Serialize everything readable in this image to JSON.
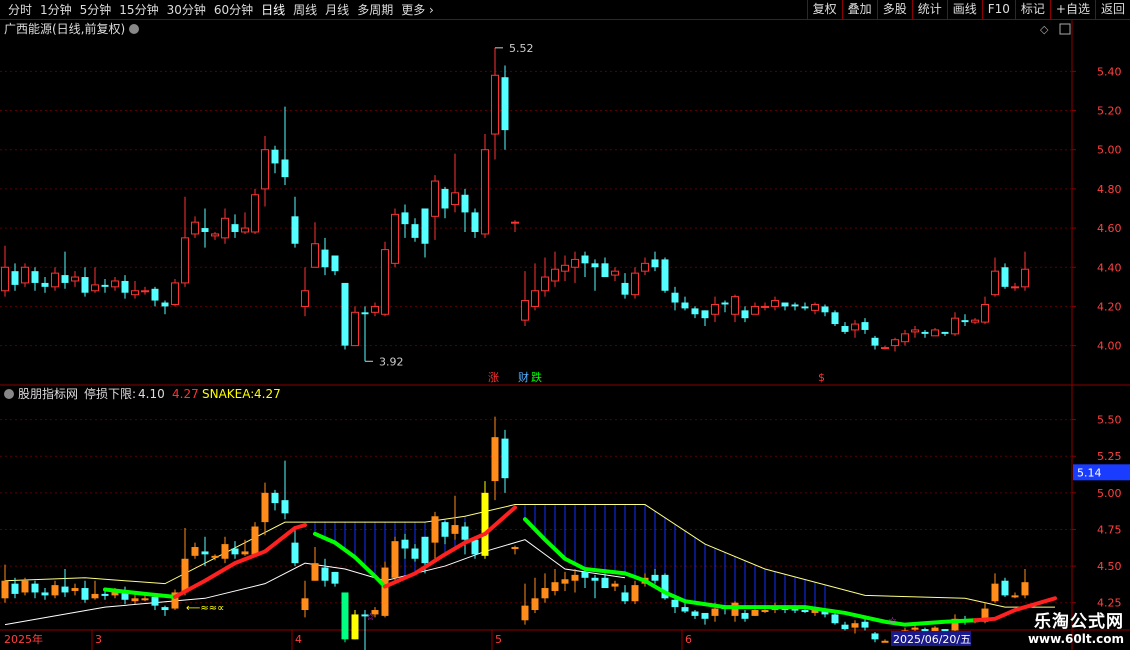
{
  "toolbar": {
    "periods": [
      "分时",
      "1分钟",
      "5分钟",
      "15分钟",
      "30分钟",
      "60分钟",
      "日线",
      "周线",
      "月线",
      "多周期"
    ],
    "active_period": "日线",
    "more_label": "更多",
    "right_buttons": [
      "复权",
      "叠加",
      "多股",
      "统计",
      "画线",
      "F10",
      "标记",
      "+自选",
      "返回"
    ]
  },
  "main_panel": {
    "title": "广西能源(日线,前复权)",
    "high_label": "5.52",
    "low_label": "3.92",
    "events": [
      "涨",
      "财",
      "跌",
      "$"
    ]
  },
  "indicator_panel": {
    "name": "股朋指标网",
    "stop_label": "停损下限:",
    "stop_value": "4.10",
    "value2": "4.27",
    "snake_label": "SNAKEA:",
    "snake_value": "4.27",
    "current_price": "5.14",
    "signal_text": "⟵≈≈∝"
  },
  "xaxis": {
    "year_label": "2025年",
    "months": [
      {
        "label": "3",
        "index": 9
      },
      {
        "label": "4",
        "index": 29
      },
      {
        "label": "5",
        "index": 49
      },
      {
        "label": "6",
        "index": 68
      }
    ],
    "cursor_date": "2025/06/20/五"
  },
  "watermark": {
    "title": "乐淘公式网",
    "url": "www.60lt.com"
  },
  "colors": {
    "up": "#ff3232",
    "down": "#54ffff",
    "snake_green": "#00ff00",
    "snake_red": "#ff2020",
    "orange": "#ff8c1a",
    "yellow": "#ffff00",
    "blue_fill": "#1030ff",
    "accent_red": "#8b0000"
  },
  "chart_data": {
    "type": "candlestick",
    "main_yaxis": {
      "ticks": [
        4.0,
        4.2,
        4.4,
        4.6,
        4.8,
        5.0,
        5.2,
        5.4
      ],
      "ylim": [
        3.85,
        5.56
      ]
    },
    "ind_yaxis": {
      "ticks": [
        4.25,
        4.5,
        4.75,
        5.0,
        5.25,
        5.5
      ],
      "ylim": [
        4.05,
        5.62
      ]
    },
    "candles": [
      [
        4.28,
        4.4,
        4.51,
        4.25
      ],
      [
        4.38,
        4.31,
        4.42,
        4.28
      ],
      [
        4.32,
        4.4,
        4.42,
        4.3
      ],
      [
        4.38,
        4.32,
        4.4,
        4.28
      ],
      [
        4.32,
        4.3,
        4.35,
        4.27
      ],
      [
        4.3,
        4.37,
        4.4,
        4.28
      ],
      [
        4.36,
        4.32,
        4.48,
        4.29
      ],
      [
        4.33,
        4.35,
        4.38,
        4.3
      ],
      [
        4.35,
        4.27,
        4.4,
        4.25
      ],
      [
        4.28,
        4.31,
        4.4,
        4.27
      ],
      [
        4.31,
        4.3,
        4.34,
        4.27
      ],
      [
        4.3,
        4.33,
        4.35,
        4.28
      ],
      [
        4.33,
        4.27,
        4.36,
        4.24
      ],
      [
        4.26,
        4.28,
        4.33,
        4.24
      ],
      [
        4.28,
        4.28,
        4.3,
        4.26
      ],
      [
        4.29,
        4.23,
        4.3,
        4.2
      ],
      [
        4.22,
        4.2,
        4.23,
        4.16
      ],
      [
        4.21,
        4.32,
        4.34,
        4.2
      ],
      [
        4.32,
        4.55,
        4.76,
        4.3
      ],
      [
        4.57,
        4.63,
        4.66,
        4.55
      ],
      [
        4.6,
        4.58,
        4.7,
        4.5
      ],
      [
        4.56,
        4.57,
        4.58,
        4.54
      ],
      [
        4.55,
        4.65,
        4.7,
        4.52
      ],
      [
        4.62,
        4.58,
        4.67,
        4.55
      ],
      [
        4.58,
        4.6,
        4.68,
        4.57
      ],
      [
        4.58,
        4.77,
        4.8,
        4.57
      ],
      [
        4.8,
        5.0,
        5.07,
        4.71
      ],
      [
        5.0,
        4.93,
        5.02,
        4.88
      ],
      [
        4.95,
        4.86,
        5.22,
        4.82
      ],
      [
        4.66,
        4.52,
        4.76,
        4.5
      ],
      [
        4.2,
        4.28,
        4.4,
        4.15
      ],
      [
        4.4,
        4.52,
        4.63,
        4.4
      ],
      [
        4.49,
        4.4,
        4.55,
        4.36
      ],
      [
        4.46,
        4.38,
        4.46,
        4.36
      ],
      [
        4.32,
        4.0,
        4.3,
        3.98
      ],
      [
        4.0,
        4.17,
        4.2,
        4.0
      ],
      [
        4.17,
        4.16,
        4.2,
        3.92
      ],
      [
        4.17,
        4.2,
        4.22,
        4.15
      ],
      [
        4.16,
        4.49,
        4.53,
        4.15
      ],
      [
        4.42,
        4.67,
        4.7,
        4.4
      ],
      [
        4.68,
        4.62,
        4.72,
        4.55
      ],
      [
        4.62,
        4.55,
        4.65,
        4.53
      ],
      [
        4.7,
        4.52,
        4.67,
        4.45
      ],
      [
        4.66,
        4.84,
        4.87,
        4.54
      ],
      [
        4.8,
        4.7,
        4.81,
        4.65
      ],
      [
        4.72,
        4.78,
        4.98,
        4.68
      ],
      [
        4.77,
        4.68,
        4.8,
        4.58
      ],
      [
        4.68,
        4.58,
        4.7,
        4.55
      ],
      [
        4.57,
        5.0,
        5.08,
        4.55
      ],
      [
        5.08,
        5.38,
        5.52,
        4.95
      ],
      [
        5.37,
        5.1,
        5.43,
        5.0
      ],
      [
        4.63,
        4.63,
        4.64,
        4.58
      ],
      [
        4.13,
        4.23,
        4.38,
        4.1
      ],
      [
        4.2,
        4.28,
        4.42,
        4.18
      ],
      [
        4.28,
        4.35,
        4.45,
        4.25
      ],
      [
        4.33,
        4.39,
        4.48,
        4.3
      ],
      [
        4.38,
        4.41,
        4.46,
        4.33
      ],
      [
        4.4,
        4.44,
        4.48,
        4.32
      ],
      [
        4.46,
        4.42,
        4.48,
        4.35
      ],
      [
        4.42,
        4.4,
        4.44,
        4.28
      ],
      [
        4.42,
        4.35,
        4.45,
        4.35
      ],
      [
        4.36,
        4.38,
        4.4,
        4.33
      ],
      [
        4.32,
        4.26,
        4.37,
        4.24
      ],
      [
        4.26,
        4.37,
        4.4,
        4.24
      ],
      [
        4.38,
        4.42,
        4.45,
        4.36
      ],
      [
        4.44,
        4.4,
        4.48,
        4.38
      ],
      [
        4.44,
        4.28,
        4.45,
        4.27
      ],
      [
        4.27,
        4.22,
        4.3,
        4.18
      ],
      [
        4.22,
        4.19,
        4.25,
        4.18
      ],
      [
        4.19,
        4.16,
        4.2,
        4.14
      ],
      [
        4.18,
        4.14,
        4.18,
        4.1
      ],
      [
        4.16,
        4.21,
        4.25,
        4.12
      ],
      [
        4.22,
        4.21,
        4.23,
        4.17
      ],
      [
        4.16,
        4.25,
        4.26,
        4.12
      ],
      [
        4.18,
        4.14,
        4.2,
        4.12
      ],
      [
        4.16,
        4.2,
        4.22,
        4.16
      ],
      [
        4.2,
        4.2,
        4.22,
        4.18
      ],
      [
        4.2,
        4.23,
        4.25,
        4.18
      ],
      [
        4.22,
        4.2,
        4.22,
        4.18
      ],
      [
        4.21,
        4.2,
        4.22,
        4.18
      ],
      [
        4.2,
        4.19,
        4.22,
        4.18
      ],
      [
        4.18,
        4.21,
        4.22,
        4.16
      ],
      [
        4.2,
        4.17,
        4.21,
        4.15
      ],
      [
        4.17,
        4.11,
        4.18,
        4.1
      ],
      [
        4.1,
        4.07,
        4.12,
        4.06
      ],
      [
        4.08,
        4.11,
        4.13,
        4.04
      ],
      [
        4.12,
        4.08,
        4.14,
        4.06
      ],
      [
        4.04,
        4.0,
        4.05,
        3.98
      ],
      [
        3.99,
        3.99,
        4.0,
        3.98
      ],
      [
        4.0,
        4.03,
        4.04,
        3.97
      ],
      [
        4.02,
        4.06,
        4.08,
        4.0
      ],
      [
        4.07,
        4.08,
        4.1,
        4.04
      ],
      [
        4.07,
        4.06,
        4.08,
        4.04
      ],
      [
        4.05,
        4.08,
        4.09,
        4.05
      ],
      [
        4.07,
        4.06,
        4.07,
        4.05
      ],
      [
        4.06,
        4.14,
        4.17,
        4.05
      ],
      [
        4.13,
        4.12,
        4.16,
        4.1
      ],
      [
        4.12,
        4.13,
        4.14,
        4.11
      ],
      [
        4.12,
        4.21,
        4.25,
        4.11
      ],
      [
        4.26,
        4.38,
        4.45,
        4.25
      ],
      [
        4.4,
        4.3,
        4.42,
        4.29
      ],
      [
        4.3,
        4.3,
        4.32,
        4.28
      ],
      [
        4.3,
        4.39,
        4.48,
        4.28
      ]
    ],
    "snake_segments": [
      {
        "color": "green",
        "values": [
          [
            10,
            4.34
          ],
          [
            14,
            4.31
          ],
          [
            17,
            4.29
          ]
        ]
      },
      {
        "color": "green",
        "values": [
          [
            31,
            4.72
          ],
          [
            33,
            4.66
          ],
          [
            35,
            4.56
          ],
          [
            37,
            4.43
          ],
          [
            38,
            4.36
          ]
        ]
      },
      {
        "color": "red",
        "values": [
          [
            38,
            4.36
          ],
          [
            41,
            4.45
          ],
          [
            44,
            4.58
          ],
          [
            46,
            4.66
          ],
          [
            48,
            4.72
          ]
        ]
      },
      {
        "color": "green",
        "values": [
          [
            52,
            4.82
          ],
          [
            54,
            4.68
          ],
          [
            56,
            4.55
          ],
          [
            58,
            4.48
          ],
          [
            62,
            4.45
          ],
          [
            64,
            4.4
          ],
          [
            66,
            4.32
          ],
          [
            68,
            4.26
          ],
          [
            72,
            4.22
          ],
          [
            80,
            4.22
          ],
          [
            84,
            4.18
          ],
          [
            88,
            4.12
          ],
          [
            90,
            4.1
          ],
          [
            94,
            4.12
          ],
          [
            97,
            4.13
          ]
        ]
      },
      {
        "color": "red",
        "values": [
          [
            97,
            4.13
          ],
          [
            99,
            4.14
          ],
          [
            101,
            4.2
          ],
          [
            103,
            4.24
          ],
          [
            105,
            4.28
          ]
        ]
      },
      {
        "color": "red",
        "values": [
          [
            17,
            4.29
          ],
          [
            20,
            4.4
          ],
          [
            23,
            4.52
          ],
          [
            26,
            4.6
          ],
          [
            29,
            4.76
          ],
          [
            30,
            4.78
          ]
        ]
      },
      {
        "color": "red",
        "values": [
          [
            48,
            4.72
          ],
          [
            50,
            4.84
          ],
          [
            51,
            4.9
          ]
        ]
      }
    ],
    "upper_line": [
      [
        0,
        4.4
      ],
      [
        8,
        4.42
      ],
      [
        16,
        4.38
      ],
      [
        28,
        4.8
      ],
      [
        42,
        4.8
      ],
      [
        46,
        4.84
      ],
      [
        51,
        4.92
      ],
      [
        64,
        4.92
      ],
      [
        70,
        4.65
      ],
      [
        76,
        4.48
      ],
      [
        86,
        4.3
      ],
      [
        96,
        4.28
      ],
      [
        100,
        4.22
      ],
      [
        105,
        4.22
      ]
    ],
    "lower_line": [
      [
        0,
        4.1
      ],
      [
        10,
        4.22
      ],
      [
        20,
        4.28
      ],
      [
        26,
        4.38
      ],
      [
        30,
        4.52
      ],
      [
        34,
        4.48
      ],
      [
        38,
        4.4
      ],
      [
        44,
        4.5
      ],
      [
        48,
        4.6
      ],
      [
        52,
        4.68
      ],
      [
        54,
        4.58
      ],
      [
        56,
        4.48
      ],
      [
        62,
        4.42
      ]
    ],
    "blue_fill_ranges": [
      [
        31,
        46
      ],
      [
        52,
        82
      ]
    ]
  }
}
